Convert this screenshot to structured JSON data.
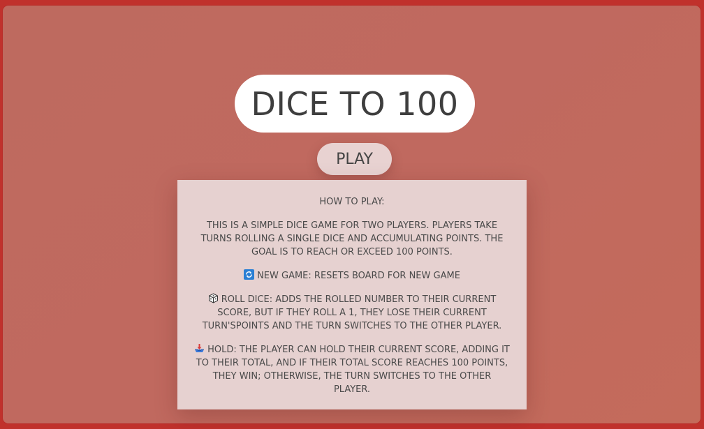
{
  "app": {
    "title": "DICE TO 100",
    "play_label": "PLAY"
  },
  "rules": {
    "heading": "HOW TO PLAY:",
    "intro": "THIS IS A SIMPLE DICE GAME FOR TWO PLAYERS. PLAYERS TAKE TURNS ROLLING A SINGLE DICE AND ACCUMULATING POINTS. THE GOAL IS TO REACH OR EXCEED 100 POINTS.",
    "new_game": {
      "icon": "refresh-icon",
      "text": "NEW GAME: RESETS BOARD FOR NEW GAME"
    },
    "roll_dice": {
      "icon": "dice-icon",
      "text": "ROLL DICE: ADDS THE ROLLED NUMBER TO THEIR CURRENT SCORE, BUT IF THEY ROLL A 1, THEY LOSE THEIR CURRENT TURN'SPOINTS AND THE TURN SWITCHES TO THE OTHER PLAYER."
    },
    "hold": {
      "icon": "inbox-tray-icon",
      "text": "HOLD: THE PLAYER CAN HOLD THEIR CURRENT SCORE, ADDING IT TO THEIR TOTAL, AND IF THEIR TOTAL SCORE REACHES 100 POINTS, THEY WIN; OTHERWISE, THE TURN SWITCHES TO THE OTHER PLAYER."
    }
  },
  "colors": {
    "frame": "#c0312c",
    "background": "#c0695f",
    "panel": "#e6d1d0",
    "text": "#4a4a4a"
  }
}
